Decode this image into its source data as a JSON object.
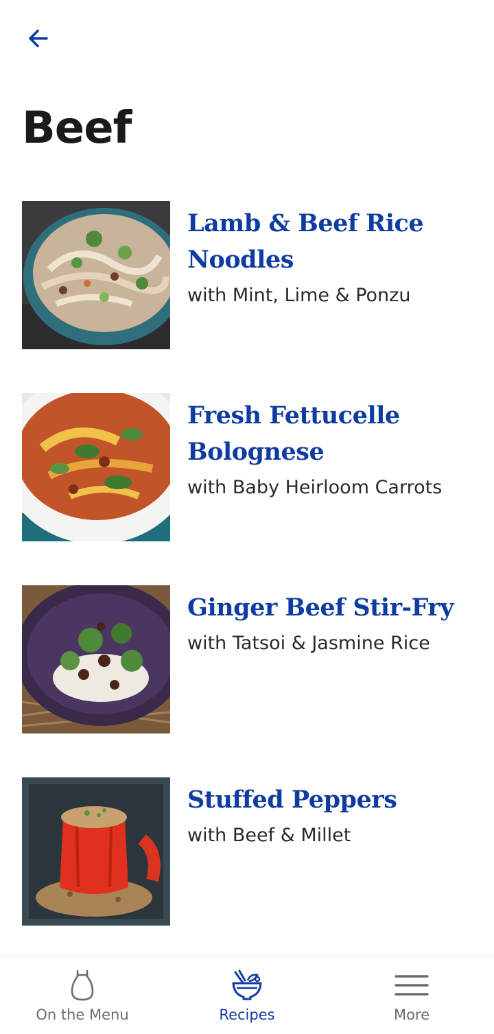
{
  "header": {
    "back_icon": "arrow-left-icon",
    "title": "Beef"
  },
  "recipes": [
    {
      "title": "Lamb & Beef Rice Noodles",
      "subtitle": "with Mint, Lime & Ponzu",
      "image": "rice-noodles-photo"
    },
    {
      "title": "Fresh Fettucelle Bolognese",
      "subtitle": "with Baby Heirloom Carrots",
      "image": "bolognese-photo"
    },
    {
      "title": "Ginger Beef Stir-Fry",
      "subtitle": "with Tatsoi & Jasmine Rice",
      "image": "stir-fry-photo"
    },
    {
      "title": "Stuffed Peppers",
      "subtitle": "with Beef & Millet",
      "image": "stuffed-peppers-photo"
    }
  ],
  "tabbar": {
    "tabs": [
      {
        "label": "On the Menu",
        "icon": "apron-icon",
        "active": false
      },
      {
        "label": "Recipes",
        "icon": "bowl-icon",
        "active": true
      },
      {
        "label": "More",
        "icon": "hamburger-menu-icon",
        "active": false
      }
    ]
  },
  "colors": {
    "accent": "#0f3ca0",
    "text": "#1a1a1a",
    "muted": "#6b6b6b"
  }
}
